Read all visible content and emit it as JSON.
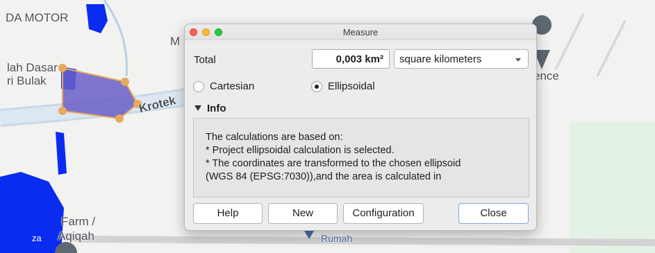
{
  "map": {
    "labels": {
      "motor": "DA MOTOR",
      "m": "M",
      "dasar": "lah Dasar",
      "bulak": "ri Bulak",
      "krotek": "Krotek",
      "ence": "ence",
      "farm": "Farm /",
      "aqiqah": "Aqiqah",
      "za": "za",
      "rumah": "Rumah"
    },
    "colors": {
      "water": "#0a2cf0",
      "polygon_fill": "#6a5fc7",
      "vertex": "#e7a95d",
      "road": "#c8d8e8",
      "park": "#e4f2e6"
    }
  },
  "dialog": {
    "title": "Measure",
    "total_label": "Total",
    "total_value": "0,003 km²",
    "unit_selected": "square kilometers",
    "radio_cartesian": "Cartesian",
    "radio_ellipsoidal": "Ellipsoidal",
    "selected_mode": "Ellipsoidal",
    "info_header": "Info",
    "info_lines": [
      "The calculations are based on:",
      "* Project ellipsoidal calculation is selected.",
      "* The coordinates are transformed to the chosen ellipsoid",
      "(WGS 84 (EPSG:7030)),and the area is calculated in"
    ],
    "buttons": {
      "help": "Help",
      "new": "New",
      "configuration": "Configuration",
      "close": "Close"
    }
  }
}
